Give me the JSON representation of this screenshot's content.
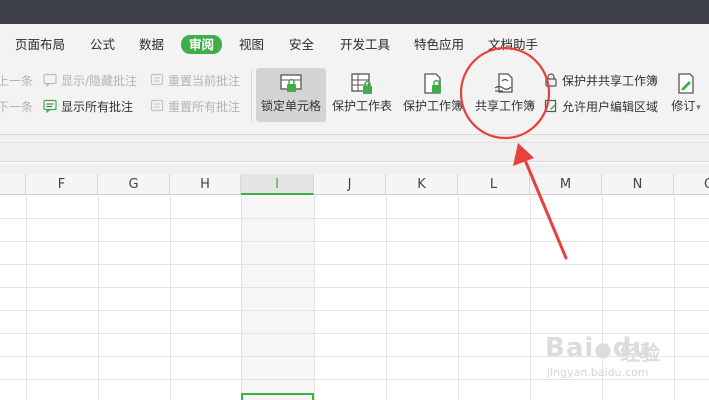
{
  "tabs": [
    {
      "label": "页面布局"
    },
    {
      "label": "公式"
    },
    {
      "label": "数据"
    },
    {
      "label": "审阅"
    },
    {
      "label": "视图"
    },
    {
      "label": "安全"
    },
    {
      "label": "开发工具"
    },
    {
      "label": "特色应用"
    },
    {
      "label": "文档助手"
    }
  ],
  "ribbon": {
    "prev_comment": "上一条",
    "next_comment": "下一条",
    "toggle_comment": "显示/隐藏批注",
    "show_all_comments": "显示所有批注",
    "reset_current_comment": "重置当前批注",
    "reset_all_comments": "重置所有批注",
    "lock_cells": "锁定单元格",
    "protect_sheet": "保护工作表",
    "protect_workbook": "保护工作簿",
    "share_workbook": "共享工作簿",
    "protect_and_share": "保护并共享工作簿",
    "allow_edit_ranges": "允许用户编辑区域",
    "track_changes": "修订",
    "track_changes_arrow": "▾"
  },
  "grid": {
    "columns": [
      "F",
      "G",
      "H",
      "I",
      "J",
      "K",
      "L",
      "M",
      "N",
      "O"
    ],
    "selected_column": "I"
  },
  "watermark": {
    "brand": "Bai",
    "brand_rest": "du",
    "brand_cn": "经验",
    "url": "jingyan.baidu.com"
  },
  "colors": {
    "accent_green": "#3fae49",
    "annotation_red": "#e8403d"
  }
}
